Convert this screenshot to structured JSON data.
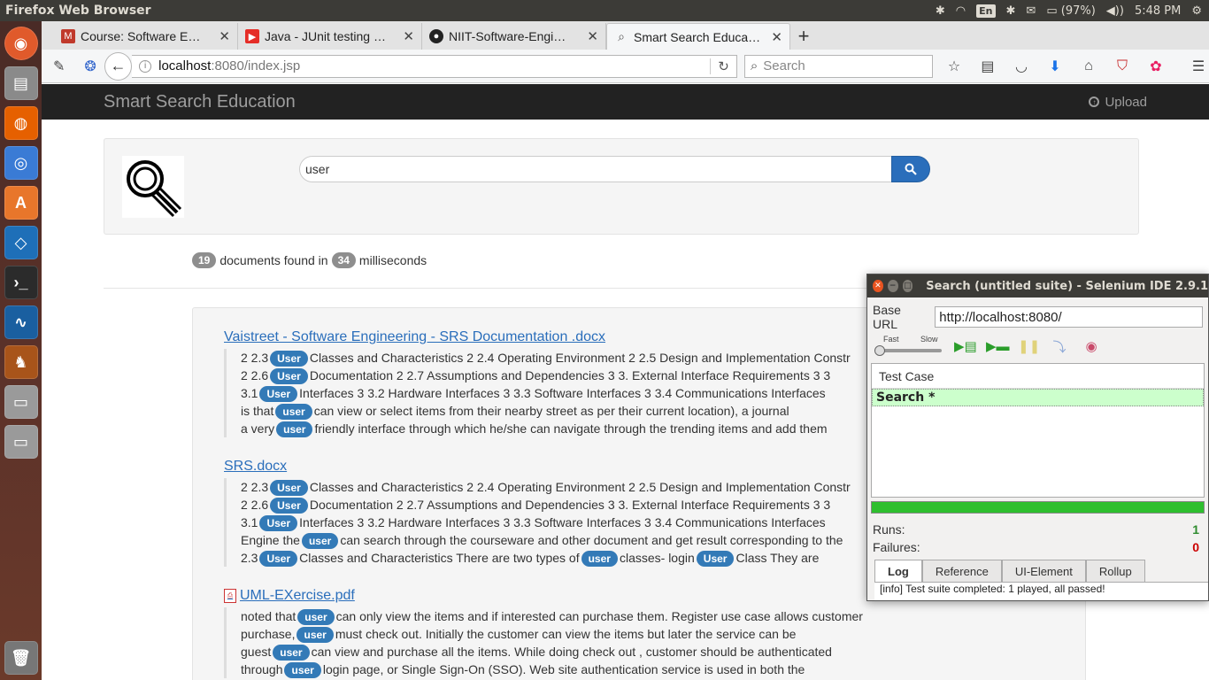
{
  "os": {
    "window_title": "Firefox Web Browser",
    "keyboard": "En",
    "battery": "(97%)",
    "clock": "5:48 PM"
  },
  "browser": {
    "tabs": [
      {
        "label": "Course: Software E…",
        "icon": "moodle-icon",
        "color": "#c0392b"
      },
      {
        "label": "Java - JUnit testing …",
        "icon": "youtube-icon",
        "color": "#e52d27"
      },
      {
        "label": "NIIT-Software-Engi…",
        "icon": "github-icon",
        "color": "#222222"
      },
      {
        "label": "Smart Search Educa…",
        "icon": "search-icon",
        "color": "#555555"
      }
    ],
    "url_host": "localhost",
    "url_path": ":8080/index.jsp",
    "search_placeholder": "Search"
  },
  "site": {
    "brand": "Smart Search Education",
    "upload": "Upload",
    "query": "user",
    "docs_count": "19",
    "docs_text": "documents found in",
    "ms_count": "34",
    "ms_text": "milliseconds"
  },
  "results": [
    {
      "title": "Vaistreet - Software Engineering - SRS Documentation .docx",
      "pdf": false,
      "snippets": [
        {
          "pre": "2 2.3",
          "kws": [
            "User"
          ],
          "parts": [
            "Classes and Characteristics 2 2.4 Operating Environment 2 2.5 Design and Implementation Constr"
          ]
        },
        {
          "pre": "2 2.6",
          "kws": [
            "User"
          ],
          "parts": [
            "Documentation 2 2.7 Assumptions and Dependencies 3 3. External Interface Requirements 3 3"
          ]
        },
        {
          "pre": "3.1",
          "kws": [
            "User"
          ],
          "parts": [
            "Interfaces 3 3.2 Hardware Interfaces 3 3.3 Software Interfaces 3 3.4 Communications Interfaces"
          ]
        },
        {
          "pre": "is that",
          "kws": [
            "user"
          ],
          "parts": [
            "can view or select items from their nearby street as per their current location), a journal"
          ]
        },
        {
          "pre": "a very",
          "kws": [
            "user"
          ],
          "parts": [
            "friendly interface through which he/she can navigate through the trending items and add them"
          ]
        }
      ]
    },
    {
      "title": "SRS.docx",
      "pdf": false,
      "snippets": [
        {
          "pre": "2 2.3",
          "kws": [
            "User"
          ],
          "parts": [
            "Classes and Characteristics 2 2.4 Operating Environment 2 2.5 Design and Implementation Constr"
          ]
        },
        {
          "pre": "2 2.6",
          "kws": [
            "User"
          ],
          "parts": [
            "Documentation 2 2.7 Assumptions and Dependencies 3 3. External Interface Requirements 3 3"
          ]
        },
        {
          "pre": "3.1",
          "kws": [
            "User"
          ],
          "parts": [
            "Interfaces 3 3.2 Hardware Interfaces 3 3.3 Software Interfaces 3 3.4 Communications Interfaces"
          ]
        },
        {
          "pre": "Engine the",
          "kws": [
            "user"
          ],
          "parts": [
            "can search through the courseware and other document and get result corresponding to the"
          ]
        },
        {
          "pre": "2.3",
          "kws": [
            "User",
            "user",
            "User"
          ],
          "parts": [
            "Classes and Characteristics There are two types of",
            "classes- login",
            "Class They are"
          ]
        }
      ]
    },
    {
      "title": " UML-EXercise.pdf",
      "pdf": true,
      "snippets": [
        {
          "pre": "noted that",
          "kws": [
            "user"
          ],
          "parts": [
            "can only view the items and if interested can purchase them. Register use case allows customer"
          ]
        },
        {
          "pre": "purchase,",
          "kws": [
            "user"
          ],
          "parts": [
            "must check out. Initially the customer can view the items but later the service can be"
          ]
        },
        {
          "pre": "guest",
          "kws": [
            "user"
          ],
          "parts": [
            "can view and purchase all the items. While doing check out , customer should be authenticated"
          ]
        },
        {
          "pre": "through",
          "kws": [
            "user"
          ],
          "parts": [
            "login page, or Single Sign-On (SSO). Web site authentication service is used in both the"
          ]
        }
      ]
    }
  ],
  "selenium": {
    "title": "Search (untitled suite) - Selenium IDE 2.9.1",
    "base_url_label": "Base URL",
    "base_url": "http://localhost:8080/",
    "fast": "Fast",
    "slow": "Slow",
    "test_case_header": "Test Case",
    "test_case": "Search *",
    "runs_label": "Runs:",
    "runs": "1",
    "runs_color": "#2e8b2e",
    "failures_label": "Failures:",
    "failures": "0",
    "failures_color": "#cc0000",
    "tabs": [
      "Log",
      "Reference",
      "UI-Element",
      "Rollup"
    ],
    "log": "[info] Test suite completed: 1 played, all passed!"
  }
}
